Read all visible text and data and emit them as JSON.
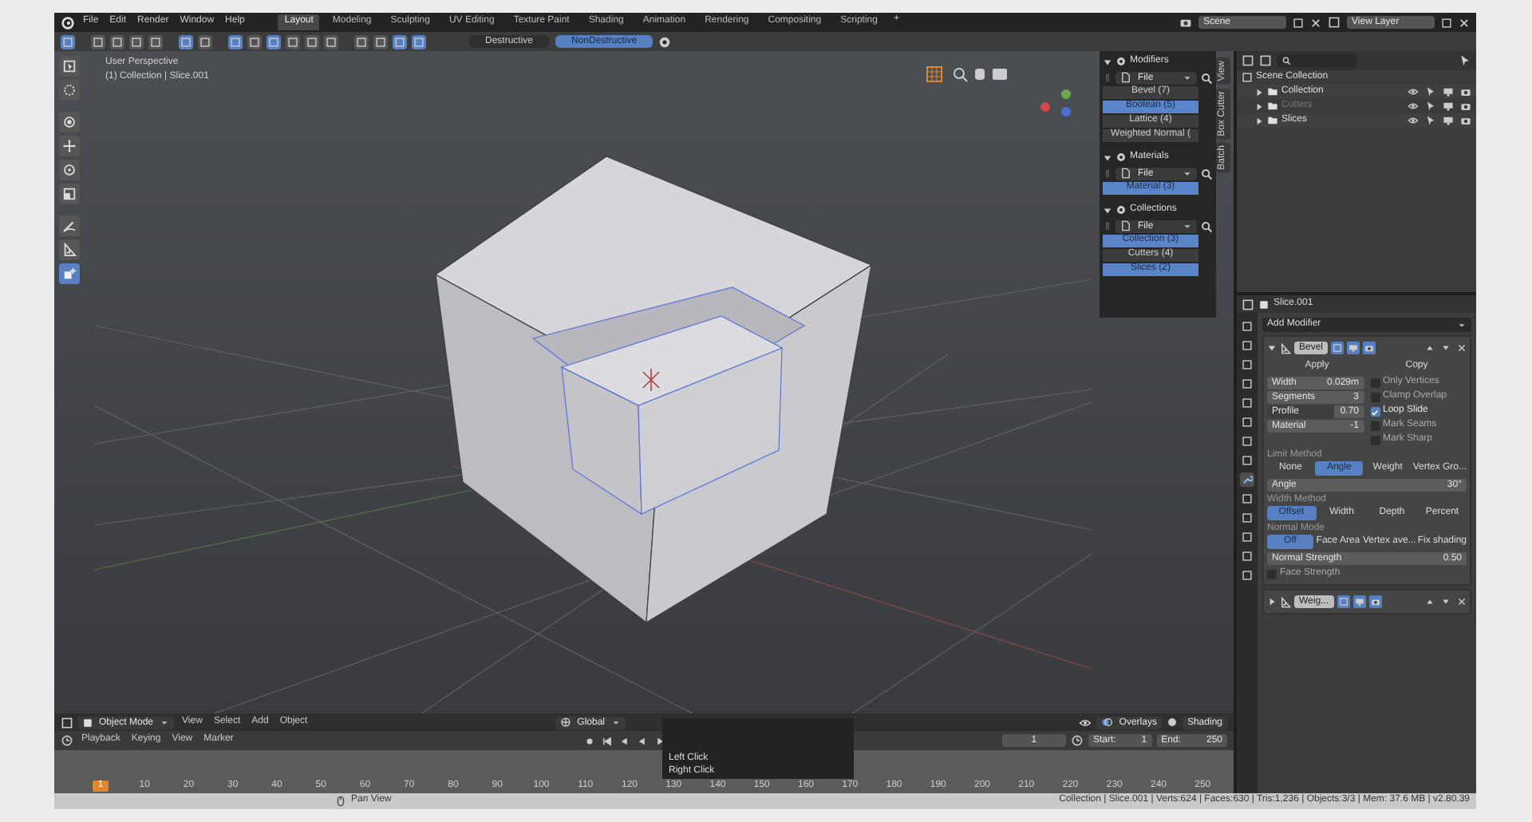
{
  "topbar": {
    "menus": [
      "File",
      "Edit",
      "Render",
      "Window",
      "Help"
    ],
    "workspaces": [
      {
        "label": "Layout",
        "selected": true
      },
      {
        "label": "Modeling",
        "selected": false
      },
      {
        "label": "Sculpting",
        "selected": false
      },
      {
        "label": "UV Editing",
        "selected": false
      },
      {
        "label": "Texture Paint",
        "selected": false
      },
      {
        "label": "Shading",
        "selected": false
      },
      {
        "label": "Animation",
        "selected": false
      },
      {
        "label": "Rendering",
        "selected": false
      },
      {
        "label": "Compositing",
        "selected": false
      },
      {
        "label": "Scripting",
        "selected": false
      }
    ],
    "add_tab": "+",
    "scene": "Scene",
    "view_layer": "View Layer"
  },
  "toolbar": {
    "tool_icons": [
      {
        "selected": true
      },
      {
        "selected": false
      },
      {
        "selected": false
      },
      {
        "selected": false
      },
      {
        "selected": false
      },
      {
        "selected": true
      },
      {
        "selected": false
      },
      {
        "selected": true
      },
      {
        "selected": false
      },
      {
        "selected": true
      },
      {
        "selected": false
      },
      {
        "selected": false
      },
      {
        "selected": false
      },
      {
        "selected": false
      },
      {
        "selected": false
      },
      {
        "selected": true
      },
      {
        "selected": true
      }
    ],
    "modes": [
      {
        "label": "Destructive",
        "selected": false
      },
      {
        "label": "NonDestructive",
        "selected": true
      }
    ]
  },
  "viewport": {
    "view_name": "User Perspective",
    "context": "(1) Collection | Slice.001",
    "tools": [
      {
        "kind": "select",
        "selected": false
      },
      {
        "kind": "cursor",
        "selected": false
      },
      {
        "kind": "move",
        "selected": false
      },
      {
        "kind": "translate",
        "selected": false
      },
      {
        "kind": "rotate",
        "selected": false
      },
      {
        "kind": "scale",
        "selected": false
      },
      {
        "kind": "annotate",
        "selected": false
      },
      {
        "kind": "measure",
        "selected": false
      },
      {
        "kind": "add",
        "selected": true
      }
    ],
    "header": {
      "mode": "Object Mode",
      "menus": [
        "View",
        "Select",
        "Add",
        "Object"
      ],
      "orientation": "Global",
      "overlays": "Overlays",
      "shading": "Shading"
    }
  },
  "side_panel": {
    "tabs": [
      "View",
      "Box Cutter",
      "Batch"
    ],
    "sections": [
      {
        "title": "Modifiers",
        "filter": "File",
        "items": [
          {
            "label": "Bevel (7)",
            "selected": false
          },
          {
            "label": "Boolean (5)",
            "selected": true
          },
          {
            "label": "Lattice (4)",
            "selected": false
          },
          {
            "label": "Weighted Normal (",
            "selected": false
          }
        ]
      },
      {
        "title": "Materials",
        "filter": "File",
        "items": [
          {
            "label": "Material (3)",
            "selected": true
          }
        ]
      },
      {
        "title": "Collections",
        "filter": "File",
        "items": [
          {
            "label": "Collection (3)",
            "selected": true
          },
          {
            "label": "Cutters (4)",
            "selected": false
          },
          {
            "label": "Slices (2)",
            "selected": true
          }
        ]
      }
    ]
  },
  "outliner": {
    "tree": [
      {
        "label": "Scene Collection",
        "children": [
          {
            "label": "Collection",
            "disabled": false
          },
          {
            "label": "Cutters",
            "disabled": true
          },
          {
            "label": "Slices",
            "disabled": false
          }
        ]
      }
    ]
  },
  "properties": {
    "object": "Slice.001",
    "add_modifier": "Add Modifier",
    "tabs": [
      {
        "selected": false
      },
      {
        "selected": false
      },
      {
        "selected": false
      },
      {
        "selected": false
      },
      {
        "selected": false
      },
      {
        "selected": false
      },
      {
        "selected": false
      },
      {
        "selected": false
      },
      {
        "selected": true
      },
      {
        "selected": false
      },
      {
        "selected": false
      },
      {
        "selected": false
      },
      {
        "selected": false
      },
      {
        "selected": false
      }
    ],
    "modifiers": [
      {
        "name": "Bevel",
        "expanded": true,
        "apply": "Apply",
        "copy": "Copy",
        "fields": [
          {
            "kind": "number",
            "label": "Width",
            "value": "0.029m"
          },
          {
            "kind": "number",
            "label": "Segments",
            "value": "3"
          },
          {
            "kind": "slider",
            "label": "Profile",
            "value": "0.70",
            "level": 0.7
          },
          {
            "kind": "number",
            "label": "Material",
            "value": "-1"
          }
        ],
        "checks": [
          {
            "label": "Only Vertices",
            "checked": false
          },
          {
            "label": "Clamp Overlap",
            "checked": false
          },
          {
            "label": "Loop Slide",
            "checked": true
          },
          {
            "label": "Mark Seams",
            "checked": false
          },
          {
            "label": "Mark Sharp",
            "checked": false
          }
        ],
        "limit_method": {
          "title": "Limit Method",
          "options": [
            {
              "label": "None",
              "selected": false
            },
            {
              "label": "Angle",
              "selected": true
            },
            {
              "label": "Weight",
              "selected": false
            },
            {
              "label": "Vertex Gro...",
              "selected": false
            }
          ]
        },
        "angle": {
          "label": "Angle",
          "value": "30°"
        },
        "width_method": {
          "title": "Width Method",
          "options": [
            {
              "label": "Offset",
              "selected": true
            },
            {
              "label": "Width",
              "selected": false
            },
            {
              "label": "Depth",
              "selected": false
            },
            {
              "label": "Percent",
              "selected": false
            }
          ]
        },
        "normal_mode": {
          "title": "Normal Mode",
          "options": [
            {
              "label": "Off",
              "selected": true
            },
            {
              "label": "Face Area",
              "selected": false
            },
            {
              "label": "Vertex ave...",
              "selected": false
            },
            {
              "label": "Fix shading",
              "selected": false
            }
          ]
        },
        "normal_strength": {
          "label": "Normal Strength",
          "value": "0.50"
        },
        "face_strength": {
          "label": "Face Strength",
          "checked": false
        }
      },
      {
        "name": "Weig...",
        "expanded": false
      }
    ]
  },
  "timeline": {
    "menus": [
      "Playback",
      "Keying",
      "View",
      "Marker"
    ],
    "current_frame": "1",
    "start_label": "Start:",
    "start_value": "1",
    "end_label": "End:",
    "end_value": "250",
    "ruler": [
      {
        "label": "1",
        "current": true
      },
      {
        "label": "10",
        "current": false
      },
      {
        "label": "20",
        "current": false
      },
      {
        "label": "30",
        "current": false
      },
      {
        "label": "40",
        "current": false
      },
      {
        "label": "50",
        "current": false
      },
      {
        "label": "60",
        "current": false
      },
      {
        "label": "70",
        "current": false
      },
      {
        "label": "80",
        "current": false
      },
      {
        "label": "90",
        "current": false
      },
      {
        "label": "100",
        "current": false
      },
      {
        "label": "110",
        "current": false
      },
      {
        "label": "120",
        "current": false
      },
      {
        "label": "130",
        "current": false
      },
      {
        "label": "140",
        "current": false
      },
      {
        "label": "150",
        "current": false
      },
      {
        "label": "160",
        "current": false
      },
      {
        "label": "170",
        "current": false
      },
      {
        "label": "180",
        "current": false
      },
      {
        "label": "190",
        "current": false
      },
      {
        "label": "200",
        "current": false
      },
      {
        "label": "210",
        "current": false
      },
      {
        "label": "220",
        "current": false
      },
      {
        "label": "230",
        "current": false
      },
      {
        "label": "240",
        "current": false
      },
      {
        "label": "250",
        "current": false
      }
    ]
  },
  "popup": [
    "Left Click",
    "Right Click"
  ],
  "status_bar": {
    "action": "Pan View",
    "stats": "Collection | Slice.001 | Verts:624 | Faces:630 | Tris:1,236 | Objects:3/3 | Mem: 37.6 MB | v2.80.39"
  }
}
